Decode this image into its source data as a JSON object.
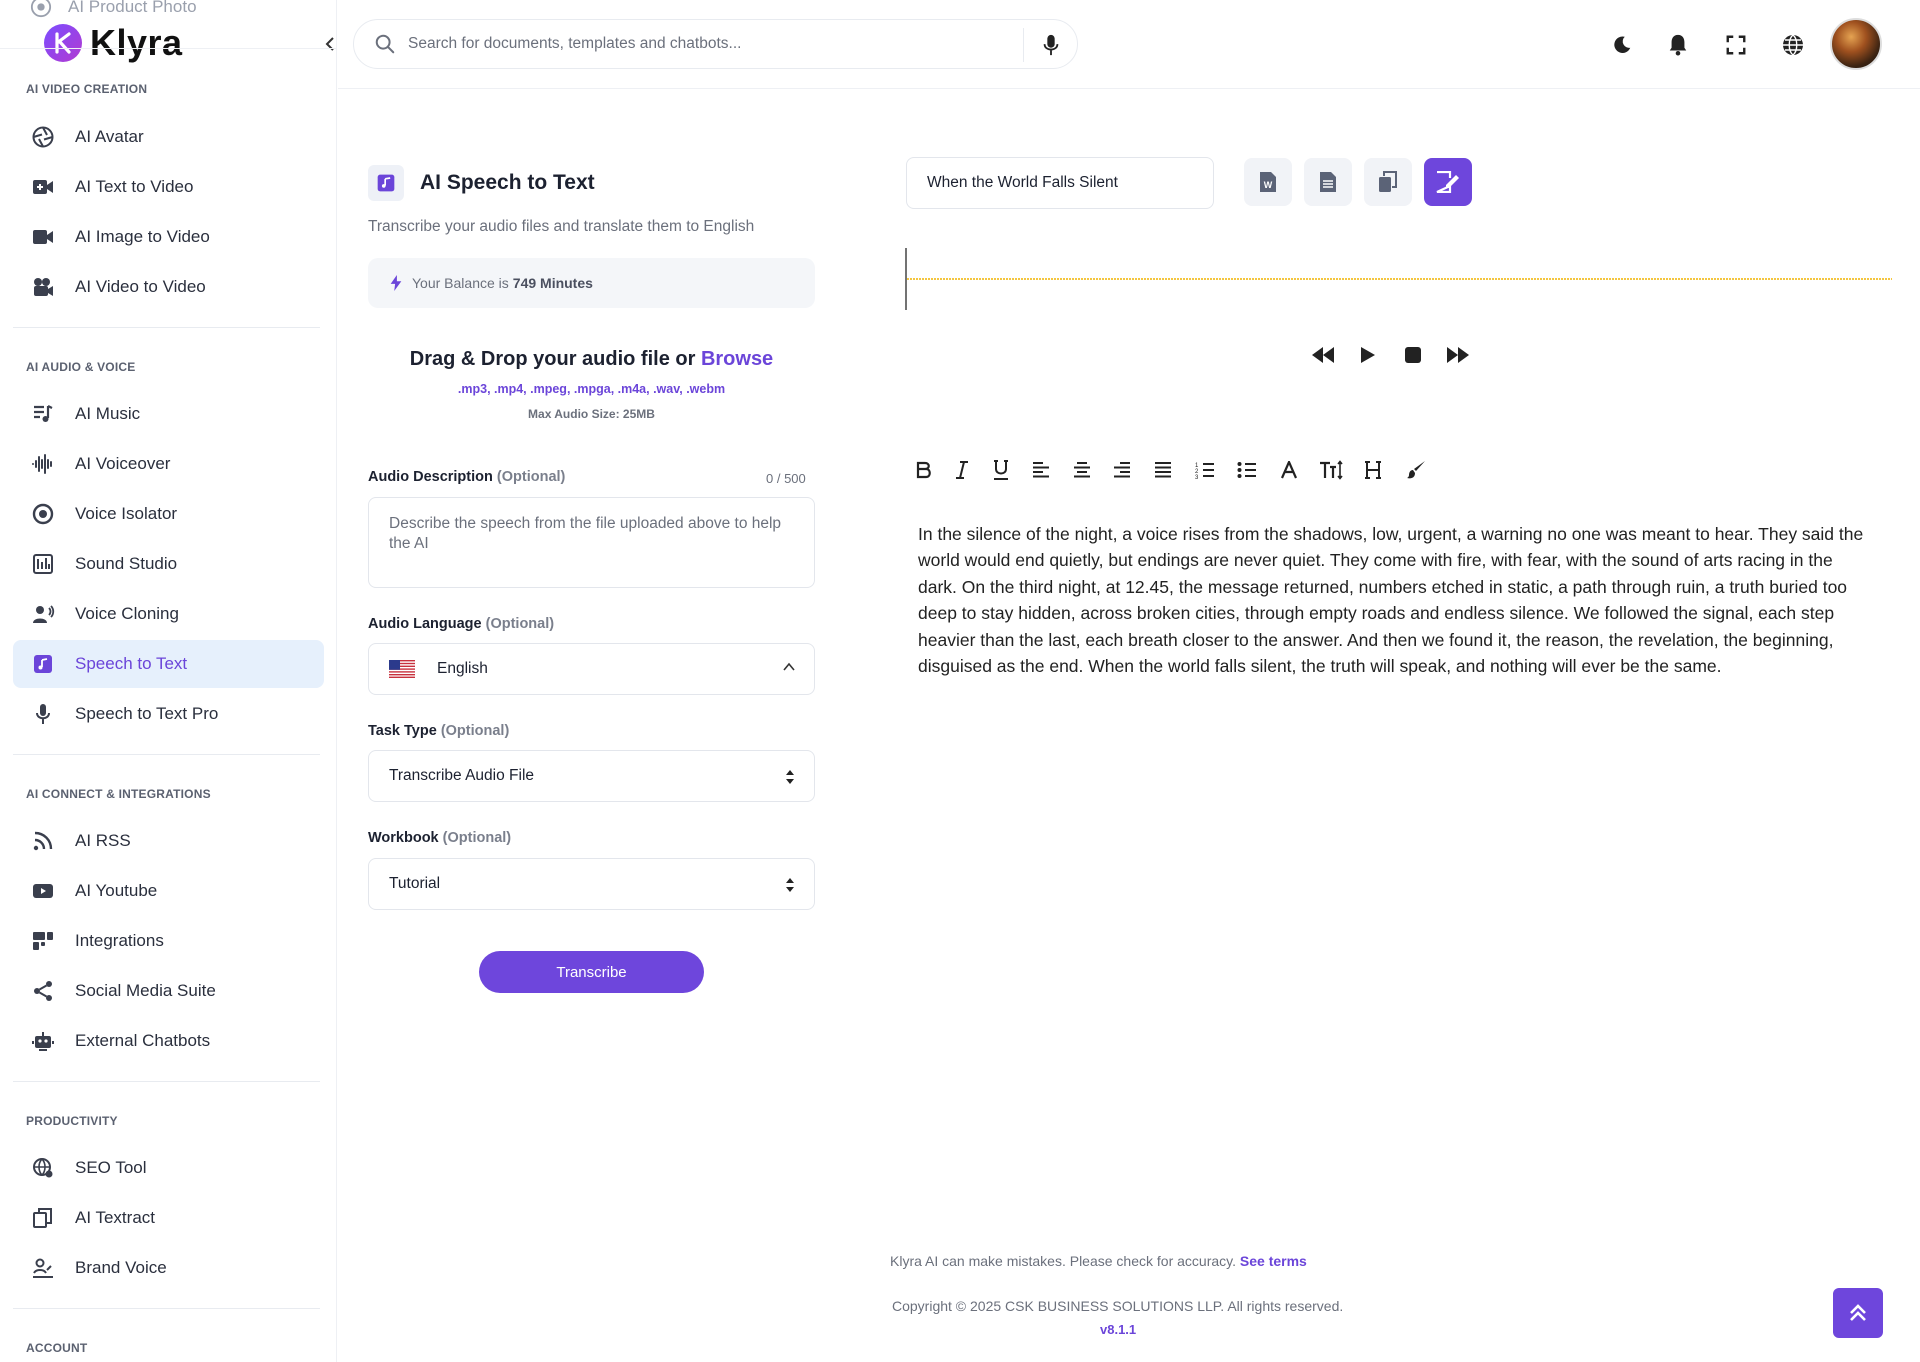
{
  "sidebar": {
    "ghost_item": "AI Product Photo",
    "brand": "Klyra",
    "sections": [
      {
        "title": "AI VIDEO CREATION",
        "items": [
          "AI Avatar",
          "AI Text to Video",
          "AI Image to Video",
          "AI Video to Video"
        ]
      },
      {
        "title": "AI AUDIO & VOICE",
        "items": [
          "AI Music",
          "AI Voiceover",
          "Voice Isolator",
          "Sound Studio",
          "Voice Cloning",
          "Speech to Text",
          "Speech to Text Pro"
        ]
      },
      {
        "title": "AI CONNECT & INTEGRATIONS",
        "items": [
          "AI RSS",
          "AI Youtube",
          "Integrations",
          "Social Media Suite",
          "External Chatbots"
        ]
      },
      {
        "title": "PRODUCTIVITY",
        "items": [
          "SEO Tool",
          "AI Textract",
          "Brand Voice"
        ]
      },
      {
        "title": "ACCOUNT",
        "items": []
      }
    ],
    "active_item": "Speech to Text"
  },
  "topbar": {
    "search_placeholder": "Search for documents, templates and chatbots..."
  },
  "tool": {
    "title": "AI Speech to Text",
    "subtitle": "Transcribe your audio files and translate them to English",
    "balance_prefix": "Your Balance is",
    "balance_value": "749 Minutes",
    "dropzone_title": "Drag & Drop your audio file or",
    "dropzone_browse": "Browse",
    "dropzone_formats": ".mp3, .mp4, .mpeg, .mpga, .m4a, .wav, .webm",
    "dropzone_max": "Max Audio Size: 25MB"
  },
  "form": {
    "description_label": "Audio Description",
    "description_optional": "(Optional)",
    "description_counter": "0 / 500",
    "description_placeholder": "Describe the speech from the file uploaded above to help the AI",
    "language_label": "Audio Language",
    "language_optional": "(Optional)",
    "language_value": "English",
    "task_label": "Task Type",
    "task_optional": "(Optional)",
    "task_value": "Transcribe Audio File",
    "workbook_label": "Workbook",
    "workbook_optional": "(Optional)",
    "workbook_value": "Tutorial",
    "submit_label": "Transcribe"
  },
  "result": {
    "title_value": "When the World Falls Silent",
    "text": "In the silence of the night, a voice rises from the shadows, low, urgent, a warning no one was meant to hear. They said the world would end quietly, but endings are never quiet. They come with fire, with fear, with the sound of arts racing in the dark. On the third night, at 12.45, the message returned, numbers etched in static, a path through ruin, a truth buried too deep to stay hidden, across broken cities, through empty roads and endless silence. We followed the signal, each step heavier than the last, each breath closer to the answer. And then we found it, the reason, the revelation, the beginning, disguised as the end. When the world falls silent, the truth will speak, and nothing will ever be the same."
  },
  "footer": {
    "disclaimer": "Klyra AI can make mistakes. Please check for accuracy.",
    "terms_link": "See terms",
    "copyright": "Copyright © 2025 CSK BUSINESS SOLUTIONS LLP. All rights reserved.",
    "version": "v8.1.1"
  },
  "colors": {
    "accent": "#6e46dc",
    "active_bg": "#e6f0fc",
    "waveform": "#f0b400"
  }
}
